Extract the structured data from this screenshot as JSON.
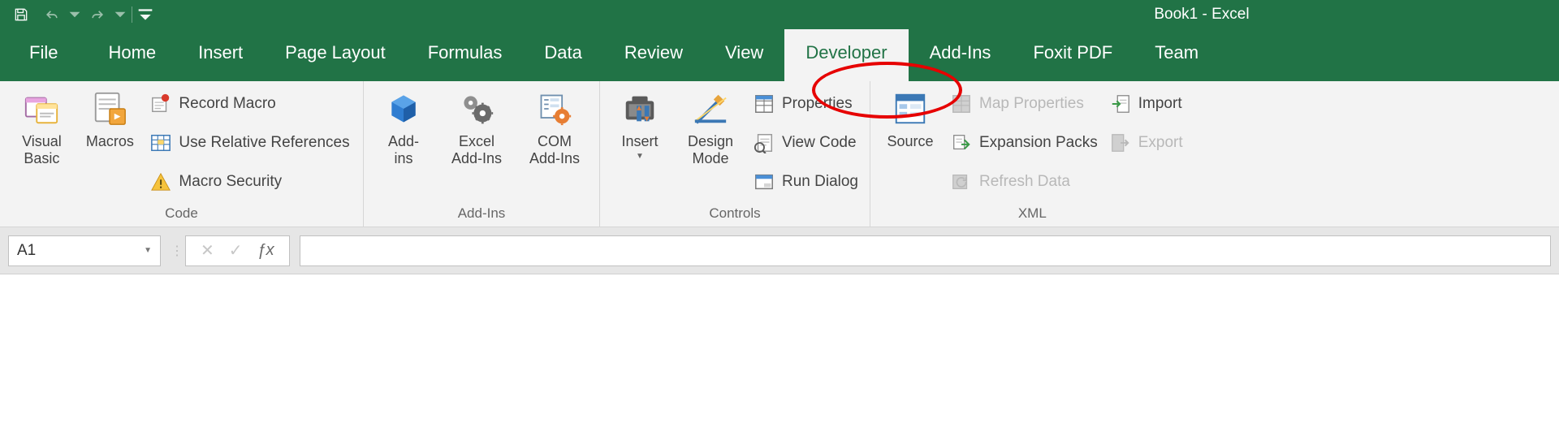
{
  "title": "Book1 - Excel",
  "tabs": [
    "File",
    "Home",
    "Insert",
    "Page Layout",
    "Formulas",
    "Data",
    "Review",
    "View",
    "Developer",
    "Add-Ins",
    "Foxit PDF",
    "Team"
  ],
  "active_tab": "Developer",
  "groups": {
    "code": {
      "label": "Code",
      "visual_basic": "Visual\nBasic",
      "macros": "Macros",
      "record_macro": "Record Macro",
      "use_relative": "Use Relative References",
      "macro_security": "Macro Security"
    },
    "addins": {
      "label": "Add-Ins",
      "addins": "Add-\nins",
      "excel_addins": "Excel\nAdd-Ins",
      "com_addins": "COM\nAdd-Ins"
    },
    "controls": {
      "label": "Controls",
      "insert": "Insert",
      "design_mode": "Design\nMode",
      "properties": "Properties",
      "view_code": "View Code",
      "run_dialog": "Run Dialog"
    },
    "xml": {
      "label": "XML",
      "source": "Source",
      "map_properties": "Map Properties",
      "expansion_packs": "Expansion Packs",
      "refresh_data": "Refresh Data",
      "import": "Import",
      "export": "Export"
    }
  },
  "namebox": "A1"
}
